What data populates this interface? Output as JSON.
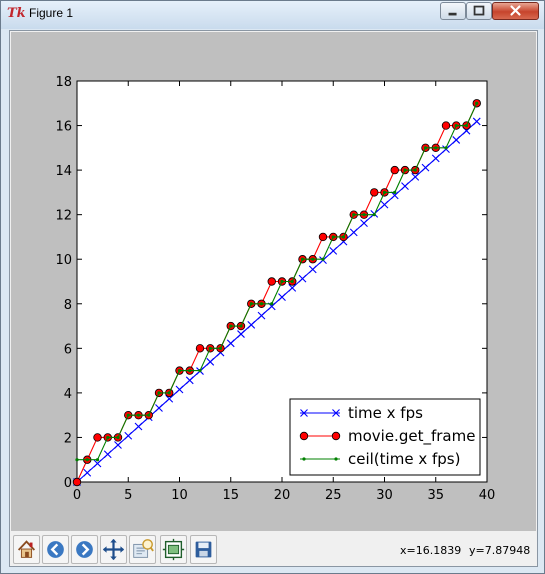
{
  "window": {
    "title": "Figure 1",
    "app_icon": "tk-feather-icon",
    "controls": [
      "minimize-icon",
      "maximize-icon",
      "close-icon"
    ]
  },
  "toolbar": {
    "buttons": [
      {
        "name": "home-button",
        "icon": "home-icon"
      },
      {
        "name": "back-button",
        "icon": "back-arrow-icon"
      },
      {
        "name": "forward-button",
        "icon": "forward-arrow-icon"
      },
      {
        "name": "pan-button",
        "icon": "move-arrows-icon"
      },
      {
        "name": "zoom-button",
        "icon": "zoom-rect-icon"
      },
      {
        "name": "subplots-button",
        "icon": "subplots-icon"
      },
      {
        "name": "save-button",
        "icon": "floppy-disk-icon"
      }
    ],
    "coords_x": "x=16.1839",
    "coords_y": "y=7.87948"
  },
  "chart_data": {
    "type": "line",
    "title": "",
    "xlabel": "",
    "ylabel": "",
    "xlim": [
      0,
      40
    ],
    "ylim": [
      0,
      18
    ],
    "xticks": [
      "0",
      "5",
      "10",
      "15",
      "20",
      "25",
      "30",
      "35",
      "40"
    ],
    "yticks": [
      "0",
      "2",
      "4",
      "6",
      "8",
      "10",
      "12",
      "14",
      "16",
      "18"
    ],
    "grid": false,
    "legend_position": "lower-right",
    "series": [
      {
        "name": "time x fps",
        "color": "#0000ff",
        "marker": "x",
        "x": [
          0,
          1,
          2,
          3,
          4,
          5,
          6,
          7,
          8,
          9,
          10,
          11,
          12,
          13,
          14,
          15,
          16,
          17,
          18,
          19,
          20,
          21,
          22,
          23,
          24,
          25,
          26,
          27,
          28,
          29,
          30,
          31,
          32,
          33,
          34,
          35,
          36,
          37,
          38,
          39
        ],
        "y": [
          0,
          0.415,
          0.83,
          1.245,
          1.66,
          2.075,
          2.49,
          2.905,
          3.32,
          3.735,
          4.15,
          4.565,
          4.98,
          5.395,
          5.81,
          6.225,
          6.64,
          7.055,
          7.47,
          7.885,
          8.3,
          8.715,
          9.13,
          9.545,
          9.96,
          10.375,
          10.79,
          11.205,
          11.62,
          12.035,
          12.45,
          12.865,
          13.28,
          13.695,
          14.11,
          14.525,
          14.94,
          15.355,
          15.77,
          16.185
        ]
      },
      {
        "name": "movie.get_frame",
        "color": "#ff0000",
        "marker": "o",
        "x": [
          0,
          1,
          2,
          3,
          4,
          5,
          6,
          7,
          8,
          9,
          10,
          11,
          12,
          13,
          14,
          15,
          16,
          17,
          18,
          19,
          20,
          21,
          22,
          23,
          24,
          25,
          26,
          27,
          28,
          29,
          30,
          31,
          32,
          33,
          34,
          35,
          36,
          37,
          38,
          39
        ],
        "y": [
          0,
          1,
          2,
          2,
          2,
          3,
          3,
          3,
          4,
          4,
          5,
          5,
          6,
          6,
          6,
          7,
          7,
          8,
          8,
          9,
          9,
          9,
          10,
          10,
          11,
          11,
          11,
          12,
          12,
          13,
          13,
          14,
          14,
          14,
          15,
          15,
          16,
          16,
          16,
          17
        ]
      },
      {
        "name": "ceil(time x fps)",
        "color": "#008000",
        "marker": ".",
        "x": [
          0,
          1,
          2,
          3,
          4,
          5,
          6,
          7,
          8,
          9,
          10,
          11,
          12,
          13,
          14,
          15,
          16,
          17,
          18,
          19,
          20,
          21,
          22,
          23,
          24,
          25,
          26,
          27,
          28,
          29,
          30,
          31,
          32,
          33,
          34,
          35,
          36,
          37,
          38,
          39
        ],
        "y": [
          1,
          1,
          1,
          2,
          2,
          3,
          3,
          3,
          4,
          4,
          5,
          5,
          5,
          6,
          6,
          7,
          7,
          8,
          8,
          8,
          9,
          9,
          10,
          10,
          10,
          11,
          11,
          12,
          12,
          12,
          13,
          13,
          14,
          14,
          15,
          15,
          15,
          16,
          16,
          17
        ]
      }
    ]
  }
}
